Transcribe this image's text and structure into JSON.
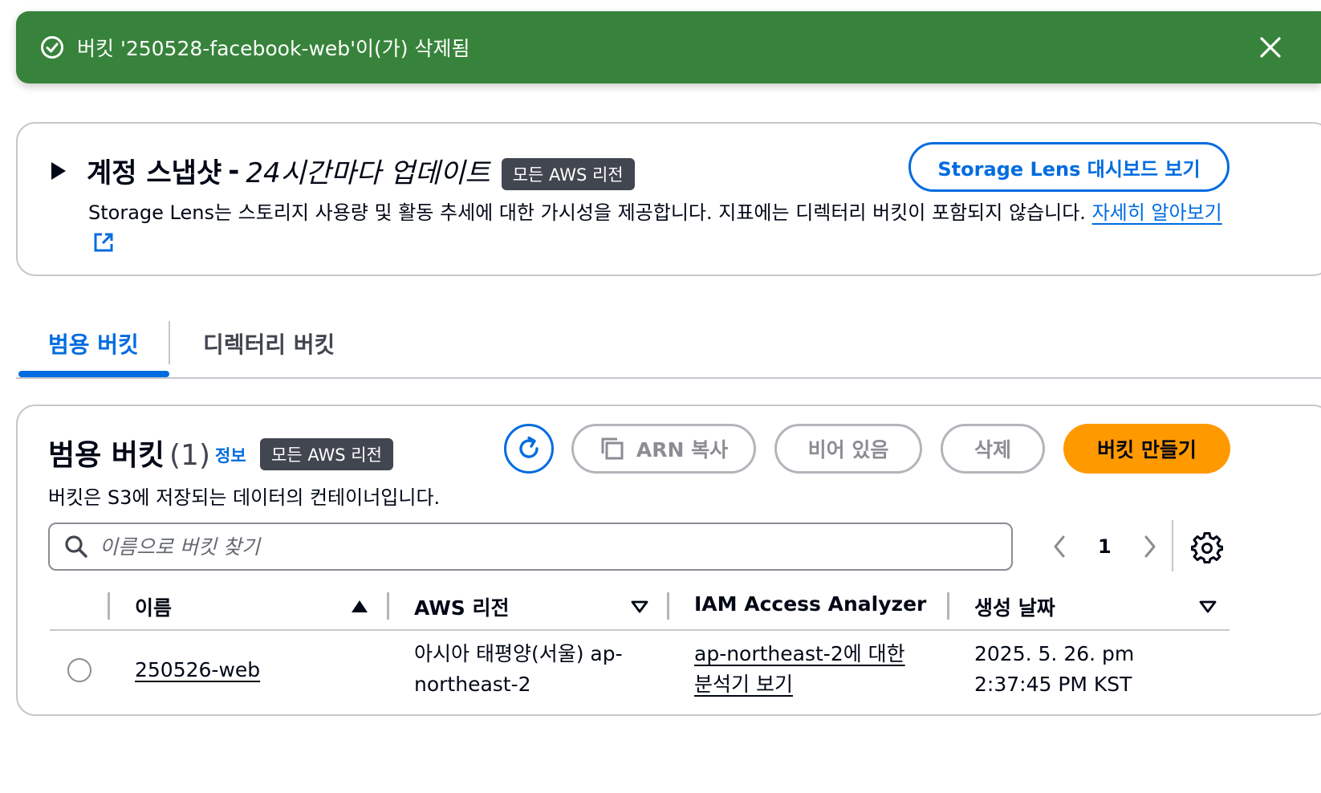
{
  "flash": {
    "message": "버킷 '250528-facebook-web'이(가) 삭제됨",
    "color": "#37833b"
  },
  "snapshot": {
    "title": "계정 스냅샷",
    "dash": "-",
    "update": "24시간마다 업데이트",
    "region_badge": "모든 AWS 리전",
    "lens_button": "Storage Lens 대시보드 보기",
    "description": "Storage Lens는 스토리지 사용량 및 활동 추세에 대한 가시성을 제공합니다. 지표에는 디렉터리 버킷이 포함되지 않습니다.",
    "learn_more": "자세히 알아보기"
  },
  "tabs": {
    "general": "범용 버킷",
    "directory": "디렉터리 버킷"
  },
  "buckets": {
    "title": "범용 버킷",
    "count": "(1)",
    "info": "정보",
    "region_badge": "모든 AWS 리전",
    "description": "버킷은 S3에 저장되는 데이터의 컨테이너입니다.",
    "buttons": {
      "copy_arn": "ARN 복사",
      "empty": "비어 있음",
      "delete": "삭제",
      "create": "버킷 만들기"
    },
    "search_placeholder": "이름으로 버킷 찾기",
    "page": "1",
    "columns": {
      "name": "이름",
      "region": "AWS 리전",
      "iam": "IAM Access Analyzer",
      "created": "생성 날짜"
    },
    "rows": [
      {
        "name": "250526-web",
        "region": "아시아 태평양(서울) ap-northeast-2",
        "iam": "ap-northeast-2에 대한 분석기 보기",
        "created": "2025. 5. 26. pm 2:37:45 PM KST"
      }
    ]
  },
  "colors": {
    "primary": "#006ce0",
    "create_button": "#ff9900",
    "badge": "#424650"
  },
  "icons": {
    "flash": "check-circle-icon",
    "close": "close-icon",
    "external": "external-link-icon",
    "refresh": "refresh-icon",
    "copy": "copy-icon",
    "search": "search-icon",
    "settings": "gear-icon"
  }
}
